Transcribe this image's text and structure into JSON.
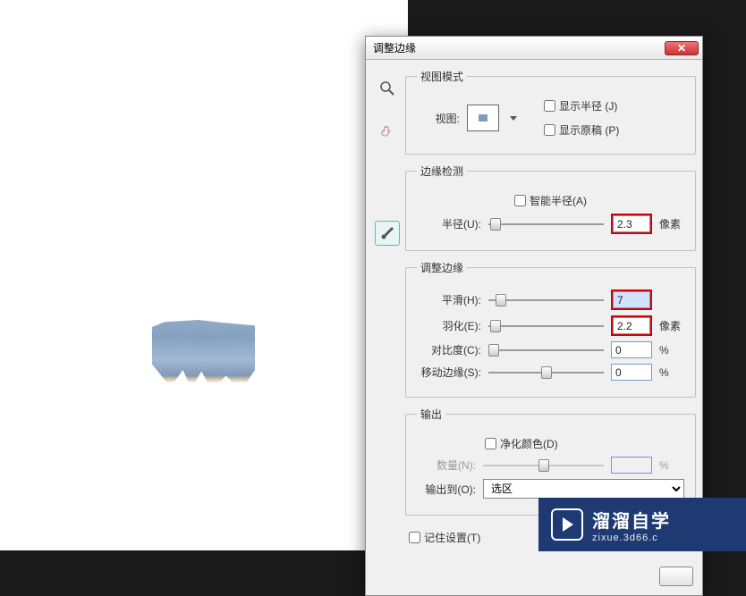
{
  "dialog": {
    "title": "调整边缘",
    "close_glyph": "✕"
  },
  "tools": {
    "zoom": "zoom-tool",
    "hand": "hand-tool",
    "brush": "refine-brush-tool"
  },
  "view_mode": {
    "legend": "视图模式",
    "view_label": "视图:",
    "show_radius": "显示半径 (J)",
    "show_original": "显示原稿 (P)"
  },
  "edge_detect": {
    "legend": "边缘检测",
    "smart_radius": "智能半径(A)",
    "radius_label": "半径(U):",
    "radius_value": "2.3",
    "radius_unit": "像素"
  },
  "adjust_edge": {
    "legend": "调整边缘",
    "smooth_label": "平滑(H):",
    "smooth_value": "7",
    "feather_label": "羽化(E):",
    "feather_value": "2.2",
    "feather_unit": "像素",
    "contrast_label": "对比度(C):",
    "contrast_value": "0",
    "contrast_unit": "%",
    "shift_label": "移动边缘(S):",
    "shift_value": "0",
    "shift_unit": "%"
  },
  "output": {
    "legend": "输出",
    "decontaminate": "净化颜色(D)",
    "amount_label": "数量(N):",
    "amount_value": "",
    "amount_unit": "%",
    "output_to_label": "输出到(O):",
    "output_to_selected": "选区"
  },
  "remember": "记住设置(T)",
  "buttons": {
    "ok": ""
  },
  "watermark": {
    "title": "溜溜自学",
    "sub": "zixue.3d66.c"
  }
}
